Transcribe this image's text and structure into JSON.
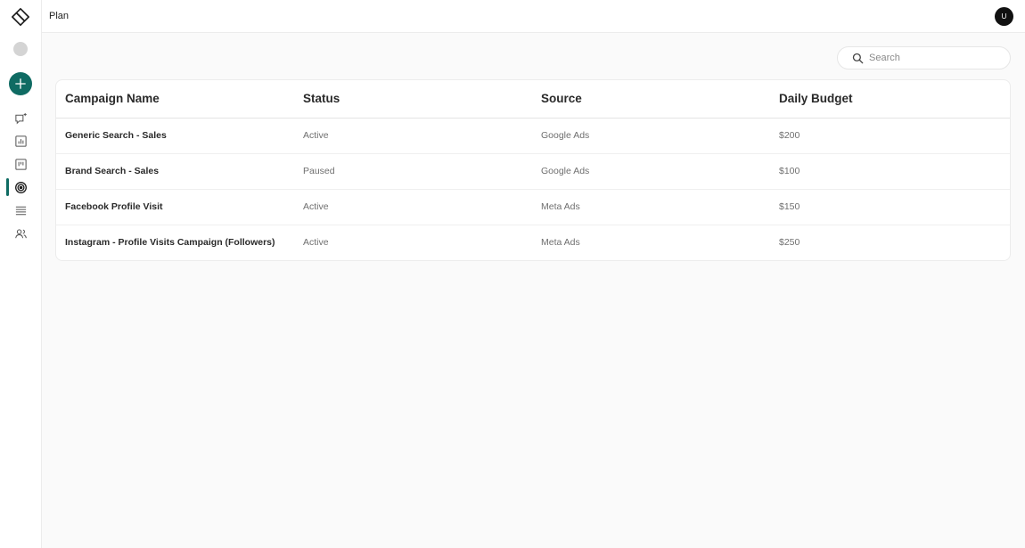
{
  "header": {
    "title": "Plan",
    "avatar_initial": "U"
  },
  "sidebar": {
    "logo_icon": "brand-logo-icon",
    "create_icon": "plus-icon",
    "items": [
      {
        "id": "chat",
        "icon": "chat-icon",
        "active": false
      },
      {
        "id": "reports",
        "icon": "bar-chart-icon",
        "active": false
      },
      {
        "id": "board",
        "icon": "kanban-icon",
        "active": false
      },
      {
        "id": "campaigns",
        "icon": "target-icon",
        "active": true
      },
      {
        "id": "list",
        "icon": "list-icon",
        "active": false
      },
      {
        "id": "audience",
        "icon": "users-icon",
        "active": false
      }
    ]
  },
  "search": {
    "placeholder": "Search",
    "value": ""
  },
  "table": {
    "columns": [
      "Campaign Name",
      "Status",
      "Source",
      "Daily Budget"
    ],
    "rows": [
      {
        "name": "Generic Search - Sales",
        "status": "Active",
        "source": "Google Ads",
        "budget": "$200"
      },
      {
        "name": "Brand Search - Sales",
        "status": "Paused",
        "source": "Google Ads",
        "budget": "$100"
      },
      {
        "name": "Facebook Profile Visit",
        "status": "Active",
        "source": "Meta Ads",
        "budget": "$150"
      },
      {
        "name": "Instagram - Profile Visits Campaign (Followers)",
        "status": "Active",
        "source": "Meta Ads",
        "budget": "$250"
      }
    ]
  },
  "colors": {
    "accent": "#0f6b63",
    "avatar_bg": "#111111"
  }
}
